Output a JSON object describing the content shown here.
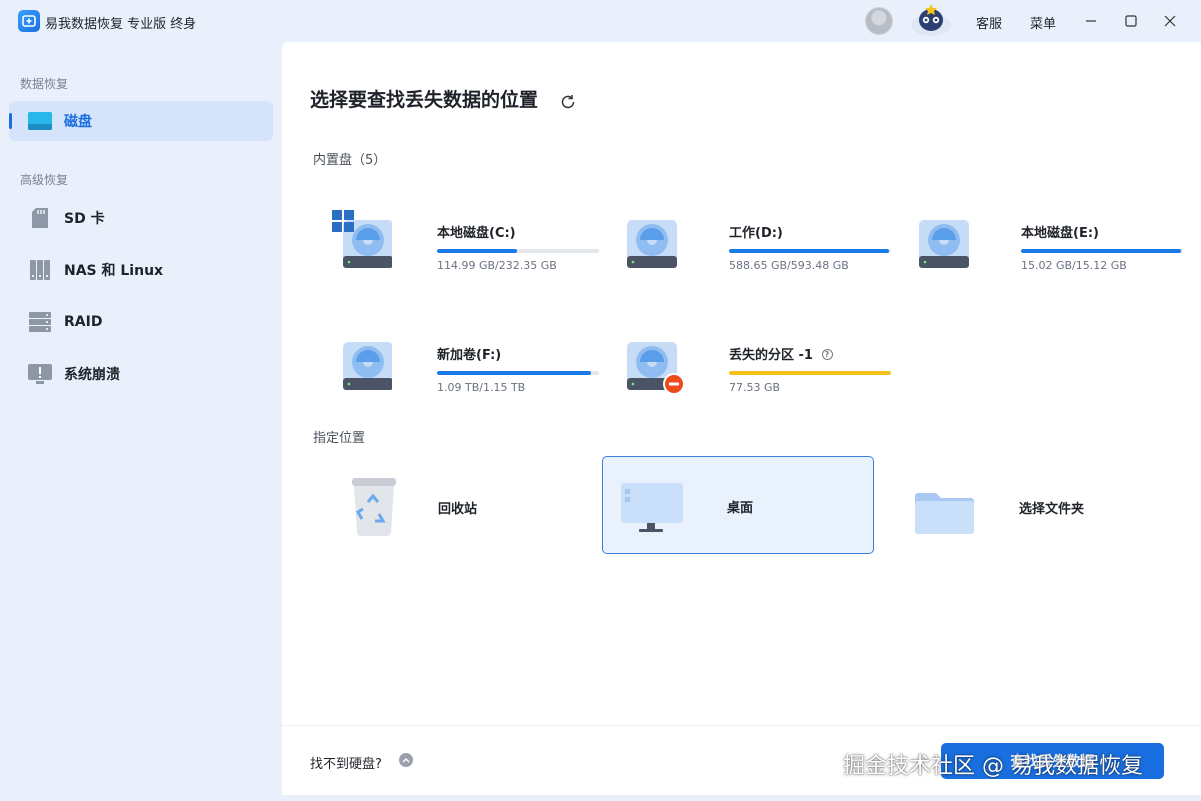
{
  "app": {
    "title": "易我数据恢复 专业版 终身",
    "accent": "#1a6fe0"
  },
  "titlebar": {
    "service_label": "客服",
    "menu_label": "菜单"
  },
  "sidebar": {
    "section_data": "数据恢复",
    "section_advanced": "高级恢复",
    "items": [
      {
        "label": "磁盘",
        "icon": "disk-icon",
        "active": true
      },
      {
        "label": "SD 卡",
        "icon": "sd-card-icon"
      },
      {
        "label": "NAS 和 Linux",
        "icon": "nas-icon"
      },
      {
        "label": "RAID",
        "icon": "raid-icon"
      },
      {
        "label": "系统崩溃",
        "icon": "system-crash-icon"
      }
    ]
  },
  "main": {
    "title": "选择要查找丢失数据的位置",
    "internal_label": "内置盘（5）",
    "drives": [
      {
        "name": "本地磁盘(C:)",
        "size": "114.99 GB/232.35 GB",
        "used": 0.495
      },
      {
        "name": "工作(D:)",
        "size": "588.65 GB/593.48 GB",
        "used": 0.99
      },
      {
        "name": "本地磁盘(E:)",
        "size": "15.02 GB/15.12 GB",
        "used": 0.99
      },
      {
        "name": "新加卷(F:)",
        "size": "1.09 TB/1.15 TB",
        "used": 0.948
      },
      {
        "name": "丢失的分区 -1",
        "size": "77.53 GB",
        "used": 1.0,
        "bar_color": "#f2c21a"
      }
    ],
    "location_label": "指定位置",
    "locations": [
      {
        "name": "回收站",
        "icon": "recycle-bin-icon"
      },
      {
        "name": "桌面",
        "icon": "desktop-icon",
        "selected": true
      },
      {
        "name": "选择文件夹",
        "icon": "folder-icon"
      }
    ]
  },
  "footer": {
    "cant_find_label": "找不到硬盘?",
    "scan_button_label": "查找丢失数据"
  },
  "watermark": "掘金技术社区 @ 易我数据恢复"
}
